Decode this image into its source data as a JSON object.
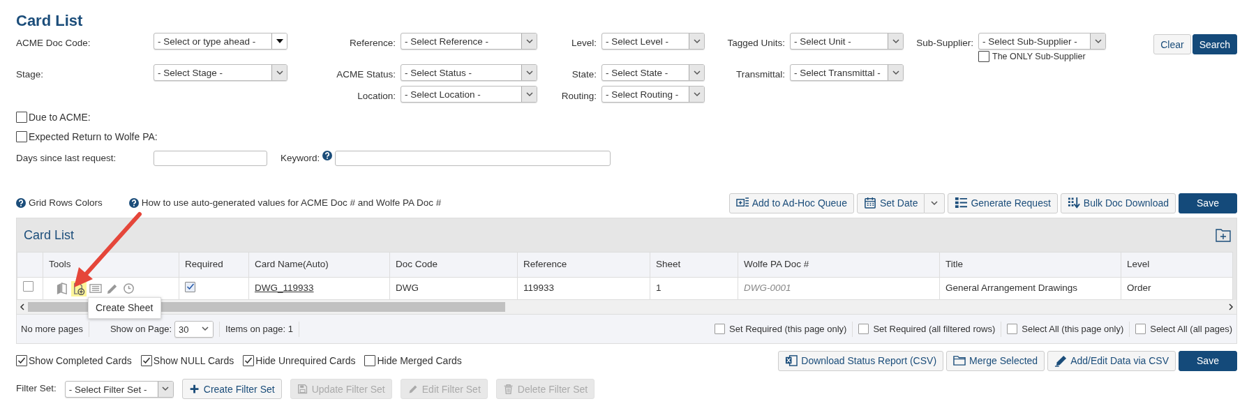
{
  "page_title": "Card List",
  "filter_columns": [
    [
      {
        "label": "ACME Doc Code:",
        "value": "- Select or type ahead -",
        "kind": "combo"
      },
      {
        "label": "Stage:",
        "value": "- Select Stage -",
        "kind": "select"
      }
    ],
    [
      {
        "label": "Reference:",
        "value": "- Select Reference -",
        "kind": "select"
      },
      {
        "label": "ACME Status:",
        "value": "- Select Status -",
        "kind": "select"
      },
      {
        "label": "Location:",
        "value": "- Select Location -",
        "kind": "select"
      }
    ],
    [
      {
        "label": "Level:",
        "value": "- Select Level -",
        "kind": "select"
      },
      {
        "label": "State:",
        "value": "- Select State -",
        "kind": "select"
      },
      {
        "label": "Routing:",
        "value": "- Select Routing -",
        "kind": "select"
      }
    ],
    [
      {
        "label": "Tagged Units:",
        "value": "- Select Unit -",
        "kind": "select"
      },
      {
        "label": "Transmittal:",
        "value": "- Select Transmittal -",
        "kind": "select"
      }
    ],
    [
      {
        "label": "Sub-Supplier:",
        "value": "- Select Sub-Supplier -",
        "kind": "select",
        "option": {
          "label": "The ONLY Sub-Supplier",
          "checked": false
        }
      }
    ]
  ],
  "search_buttons": [
    {
      "label": "Clear",
      "kind": "default"
    },
    {
      "label": "Search",
      "kind": "primary"
    }
  ],
  "date_checks": [
    {
      "label": "Due to ACME:",
      "checked": false
    },
    {
      "label": "Expected Return to Wolfe PA:",
      "checked": false
    }
  ],
  "days_field": {
    "label": "Days since last request:"
  },
  "keyword_field": {
    "label": "Keyword:"
  },
  "help_links": [
    "Grid Rows Colors",
    "How to use auto-generated values for ACME Doc # and Wolfe PA Doc #"
  ],
  "toolbar": [
    {
      "label": "Add to Ad-Hoc Queue",
      "kind": "queue"
    },
    {
      "label": "Set Date",
      "kind": "calendar"
    },
    {
      "label": "Generate Request",
      "kind": "list"
    },
    {
      "label": "Bulk Doc Download",
      "kind": "download"
    },
    {
      "label": "Save",
      "kind": "primary"
    }
  ],
  "grid": {
    "title": "Card List",
    "columns": [
      "Tools",
      "Required",
      "Card Name(Auto)",
      "Doc Code",
      "Reference",
      "Sheet",
      "Wolfe PA Doc #",
      "Title",
      "Level"
    ],
    "rows": [
      {
        "selected": false,
        "required": true,
        "tools": [
          {
            "kind": "book",
            "hovered": false
          },
          {
            "kind": "sheet-add",
            "hovered": true
          },
          {
            "kind": "list",
            "hovered": false
          },
          {
            "kind": "pencil",
            "hovered": false
          },
          {
            "kind": "clock",
            "hovered": false
          }
        ],
        "card_name": "DWG_119933",
        "doc_code": "DWG",
        "reference": "119933",
        "sheet": "1",
        "wolfe_pa_doc": "DWG-0001",
        "title": "General Arrangement Drawings",
        "level": "Order"
      }
    ],
    "tooltip": "Create Sheet"
  },
  "pager": {
    "status": "No more pages",
    "page_size_label": "Show on Page:",
    "page_size": "30",
    "items": "Items on page: 1",
    "options": [
      {
        "label": "Set Required (this page only)",
        "checked": false
      },
      {
        "label": "Set Required (all filtered rows)",
        "checked": false
      },
      {
        "label": "Select All (this page only)",
        "checked": false
      },
      {
        "label": "Select All (all pages)",
        "checked": false
      }
    ]
  },
  "view_options": [
    {
      "label": "Show Completed Cards",
      "checked": true
    },
    {
      "label": "Show NULL Cards",
      "checked": true
    },
    {
      "label": "Hide Unrequired Cards",
      "checked": true
    },
    {
      "label": "Hide Merged Cards",
      "checked": false
    }
  ],
  "bottom_buttons": [
    {
      "label": "Download Status Report (CSV)",
      "kind": "excel"
    },
    {
      "label": "Merge Selected",
      "kind": "folder"
    },
    {
      "label": "Add/Edit Data via CSV",
      "kind": "edit"
    },
    {
      "label": "Save",
      "kind": "primary"
    }
  ],
  "filter_set": {
    "label": "Filter Set:",
    "value": "- Select Filter Set -",
    "buttons": [
      {
        "label": "Create Filter Set",
        "kind": "plus",
        "disabled": false
      },
      {
        "label": "Update Filter Set",
        "kind": "disk",
        "disabled": true
      },
      {
        "label": "Edit Filter Set",
        "kind": "pencil",
        "disabled": true
      },
      {
        "label": "Delete Filter Set",
        "kind": "trash",
        "disabled": true
      }
    ]
  }
}
